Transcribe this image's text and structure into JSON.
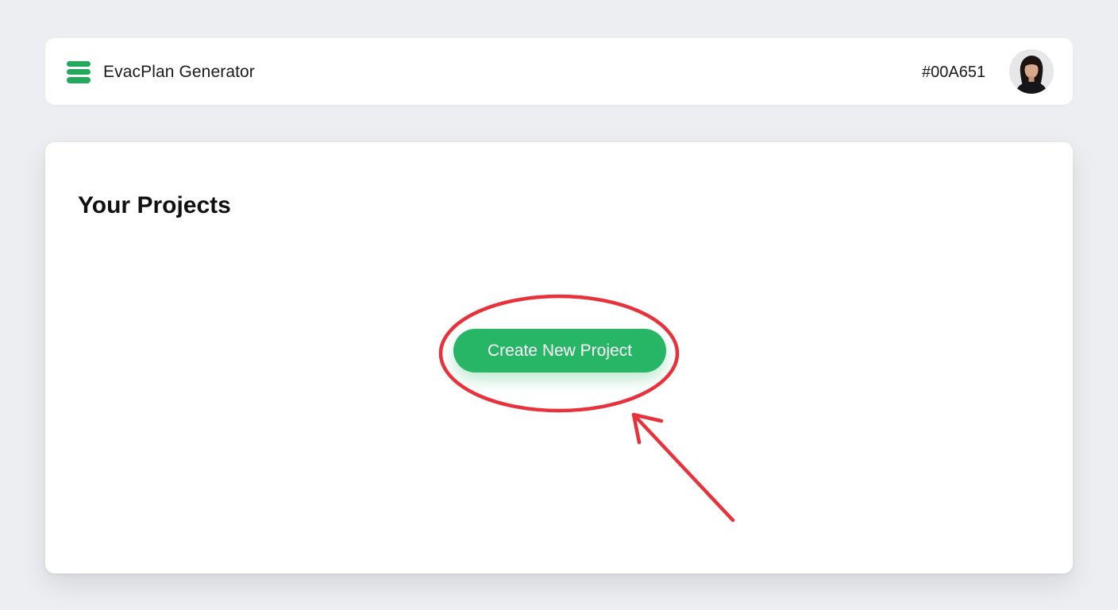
{
  "header": {
    "app_title": "EvacPlan Generator",
    "color_code": "#00A651",
    "logo_icon": "stacked-layers-icon",
    "avatar_icon": "user-avatar"
  },
  "main": {
    "section_title": "Your Projects",
    "create_button_label": "Create New Project"
  },
  "colors": {
    "accent": "#27B566",
    "annotation": "#E8313A",
    "background": "#ECEEF1"
  }
}
